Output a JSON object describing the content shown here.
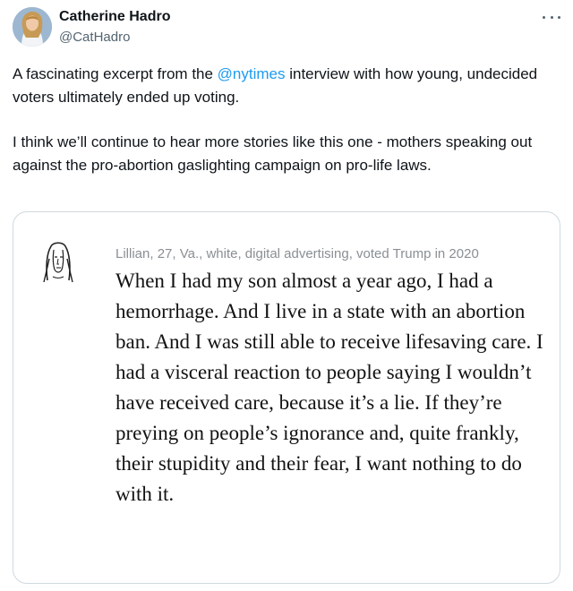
{
  "author": {
    "name": "Catherine Hadro",
    "handle": "@CatHadro",
    "avatar_icon": "profile-photo"
  },
  "more_icon": "more-horizontal-icon",
  "tweet": {
    "p1_before": "A fascinating excerpt from the ",
    "p1_mention": "@nytimes",
    "p1_after": " interview with how young, undecided voters ultimately ended up voting.",
    "p2": "I think we’ll continue to hear more stories like this one - mothers speaking out against the pro-abortion gaslighting campaign on pro-life laws."
  },
  "media": {
    "portrait_icon": "sketch-portrait-icon",
    "attribution": "Lillian, 27, Va., white, digital advertising, voted Trump in 2020",
    "quote": "When I had my son almost a year ago, I had a hemorrhage. And I live in a state with an abortion ban. And I was still able to receive lifesaving care. I had a visceral reaction to people saying I wouldn’t have received care, because it’s a lie. If they’re preying on people’s ignorance and, quite frankly, their stupidity and their fear, I want nothing to do with it."
  },
  "colors": {
    "link": "#1d9bf0",
    "secondary_text": "#536471",
    "border": "#cfd9de"
  }
}
